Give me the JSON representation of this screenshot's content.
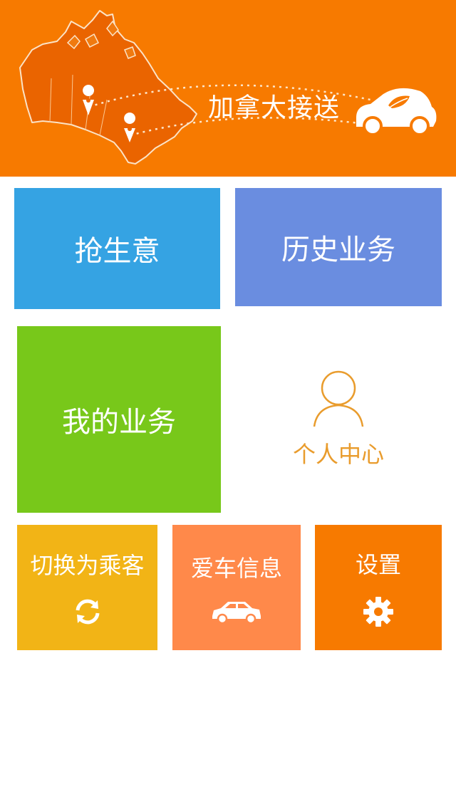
{
  "banner": {
    "title": "加拿大接送",
    "background_color": "#f77a00",
    "icons": [
      "canada-map-icon",
      "map-pin-icon",
      "car-logo-icon"
    ]
  },
  "tiles": {
    "grab_business": {
      "label": "抢生意",
      "color": "#35a3e3"
    },
    "history_business": {
      "label": "历史业务",
      "color": "#6a8de0"
    },
    "my_business": {
      "label": "我的业务",
      "color": "#78c81a"
    },
    "personal_center": {
      "label": "个人中心",
      "color": "#e99c2d",
      "icon": "person-icon"
    },
    "switch_to_passenger": {
      "label": "切换为乘客",
      "color": "#f2b416",
      "icon": "refresh-icon"
    },
    "car_info": {
      "label": "爱车信息",
      "color": "#ff894a",
      "icon": "car-icon"
    },
    "settings": {
      "label": "设置",
      "color": "#f77a00",
      "icon": "gear-icon"
    }
  }
}
